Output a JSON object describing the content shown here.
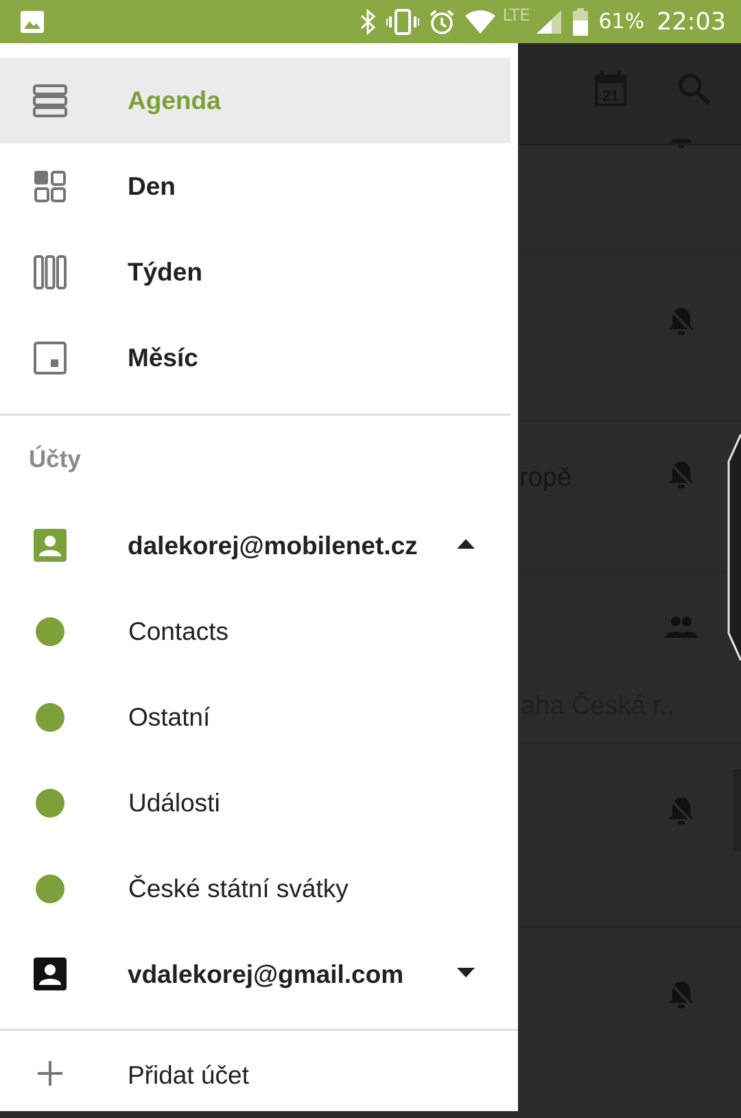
{
  "status_bar": {
    "battery_percent": "61%",
    "time": "22:03",
    "network": "LTE",
    "icons": [
      "gallery-icon",
      "bluetooth-icon",
      "vibrate-icon",
      "alarm-icon",
      "wifi-icon",
      "signal-icon",
      "battery-icon"
    ]
  },
  "drawer": {
    "views": [
      {
        "label": "Agenda",
        "icon": "agenda-view-icon",
        "active": true
      },
      {
        "label": "Den",
        "icon": "day-view-icon",
        "active": false
      },
      {
        "label": "Týden",
        "icon": "week-view-icon",
        "active": false
      },
      {
        "label": "Měsíc",
        "icon": "month-view-icon",
        "active": false
      }
    ],
    "accounts_title": "Účty",
    "accounts": [
      {
        "email": "dalekorej@mobilenet.cz",
        "expanded": true,
        "icon_color": "#7da13a",
        "calendars": [
          {
            "label": "Contacts",
            "color": "#7da13a"
          },
          {
            "label": "Ostatní",
            "color": "#7da13a"
          },
          {
            "label": "Události",
            "color": "#7da13a"
          },
          {
            "label": "České státní svátky",
            "color": "#7da13a"
          }
        ]
      },
      {
        "email": "vdalekorej@gmail.com",
        "expanded": false,
        "icon_color": "#111111"
      }
    ],
    "add_account_label": "Přidat účet"
  },
  "background_app": {
    "calendar_icon_day": "21",
    "partial_text_1": "ropě",
    "partial_text_2": "aha Česká r.."
  },
  "colors": {
    "accent": "#7da13a",
    "status_bar": "#8aa944",
    "scrim": "#2b2b2b"
  }
}
